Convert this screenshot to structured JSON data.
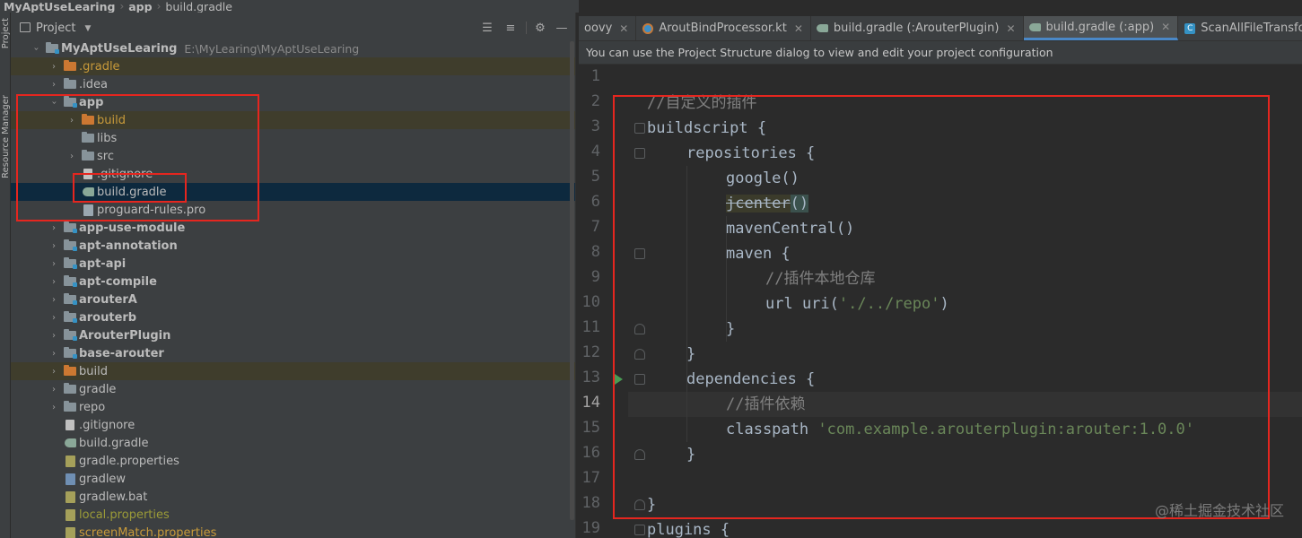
{
  "breadcrumb": [
    "MyAptUseLearing",
    "app",
    "build.gradle"
  ],
  "sidebar": {
    "project_label": "Project",
    "resource_manager_label": "Resource Manager"
  },
  "panel": {
    "title": "Project"
  },
  "tree": [
    {
      "name": "MyAptUseLearing",
      "path": "E:\\MyLearing\\MyAptUseLearing",
      "depth": 0,
      "arrow": "open",
      "icon": "folder-module",
      "bold": true
    },
    {
      "name": ".gradle",
      "depth": 1,
      "arrow": "closed",
      "icon": "folder-orange",
      "style": "orange",
      "excluded": true
    },
    {
      "name": ".idea",
      "depth": 1,
      "arrow": "closed",
      "icon": "folder"
    },
    {
      "name": "app",
      "depth": 1,
      "arrow": "open",
      "icon": "folder-module",
      "bold": true
    },
    {
      "name": "build",
      "depth": 2,
      "arrow": "closed",
      "icon": "folder-orange",
      "style": "orange",
      "excluded": true
    },
    {
      "name": "libs",
      "depth": 2,
      "arrow": "none",
      "icon": "folder"
    },
    {
      "name": "src",
      "depth": 2,
      "arrow": "closed",
      "icon": "folder"
    },
    {
      "name": ".gitignore",
      "depth": 2,
      "arrow": "none",
      "icon": "git-file"
    },
    {
      "name": "build.gradle",
      "depth": 2,
      "arrow": "none",
      "icon": "gradle-file",
      "selected": true
    },
    {
      "name": "proguard-rules.pro",
      "depth": 2,
      "arrow": "none",
      "icon": "file"
    },
    {
      "name": "app-use-module",
      "depth": 1,
      "arrow": "closed",
      "icon": "folder-module",
      "bold": true
    },
    {
      "name": "apt-annotation",
      "depth": 1,
      "arrow": "closed",
      "icon": "folder-module",
      "bold": true
    },
    {
      "name": "apt-api",
      "depth": 1,
      "arrow": "closed",
      "icon": "folder-module",
      "bold": true
    },
    {
      "name": "apt-compile",
      "depth": 1,
      "arrow": "closed",
      "icon": "folder-module",
      "bold": true
    },
    {
      "name": "arouterA",
      "depth": 1,
      "arrow": "closed",
      "icon": "folder-module",
      "bold": true
    },
    {
      "name": "arouterb",
      "depth": 1,
      "arrow": "closed",
      "icon": "folder-module",
      "bold": true
    },
    {
      "name": "ArouterPlugin",
      "depth": 1,
      "arrow": "closed",
      "icon": "folder-module",
      "bold": true
    },
    {
      "name": "base-arouter",
      "depth": 1,
      "arrow": "closed",
      "icon": "folder-module",
      "bold": true
    },
    {
      "name": "build",
      "depth": 1,
      "arrow": "closed",
      "icon": "folder-orange",
      "excluded": true
    },
    {
      "name": "gradle",
      "depth": 1,
      "arrow": "closed",
      "icon": "folder"
    },
    {
      "name": "repo",
      "depth": 1,
      "arrow": "closed",
      "icon": "folder"
    },
    {
      "name": ".gitignore",
      "depth": 1,
      "arrow": "none",
      "icon": "git-file"
    },
    {
      "name": "build.gradle",
      "depth": 1,
      "arrow": "none",
      "icon": "gradle-file"
    },
    {
      "name": "gradle.properties",
      "depth": 1,
      "arrow": "none",
      "icon": "props-file"
    },
    {
      "name": "gradlew",
      "depth": 1,
      "arrow": "none",
      "icon": "bat-file"
    },
    {
      "name": "gradlew.bat",
      "depth": 1,
      "arrow": "none",
      "icon": "props-file"
    },
    {
      "name": "local.properties",
      "depth": 1,
      "arrow": "none",
      "icon": "props-file",
      "style": "olive"
    },
    {
      "name": "screenMatch.properties",
      "depth": 1,
      "arrow": "none",
      "icon": "props-file",
      "style": "orange"
    }
  ],
  "tabs": [
    {
      "label": "oovy",
      "icon": "none",
      "close": true
    },
    {
      "label": "AroutBindProcessor.kt",
      "icon": "kotlin-icon",
      "close": true
    },
    {
      "label": "build.gradle (:ArouterPlugin)",
      "icon": "gradle-icon",
      "close": true
    },
    {
      "label": "build.gradle (:app)",
      "icon": "gradle-icon",
      "close": true,
      "active": true
    },
    {
      "label": "ScanAllFileTransform.groovy",
      "icon": "class-icon",
      "close": false
    }
  ],
  "notice": "You can use the Project Structure dialog to view and edit your project configuration",
  "line_numbers": [
    "1",
    "2",
    "3",
    "4",
    "5",
    "6",
    "7",
    "8",
    "9",
    "10",
    "11",
    "12",
    "13",
    "14",
    "15",
    "16",
    "17",
    "18",
    "19"
  ],
  "current_line": "14",
  "code": {
    "l2": "//自定义的插件",
    "l3": "buildscript {",
    "l4": "repositories {",
    "l5": "google()",
    "l6a": "jcenter",
    "l6b": "()",
    "l7": "mavenCentral()",
    "l8": "maven {",
    "l9": "//插件本地仓库",
    "l10a": "url uri(",
    "l10b": "'./../repo'",
    "l10c": ")",
    "l11": "}",
    "l12": "}",
    "l13": "dependencies {",
    "l14": "//插件依赖",
    "l15a": "classpath ",
    "l15b": "'com.example.arouterplugin:arouter:1.0.0'",
    "l16": "}",
    "l18": "}",
    "l19": "plugins {"
  },
  "watermark": "@稀土掘金技术社区",
  "colors": {
    "annotation_red": "#e5261f",
    "selection": "#0d293e",
    "tab_underline": "#4a88c7"
  }
}
